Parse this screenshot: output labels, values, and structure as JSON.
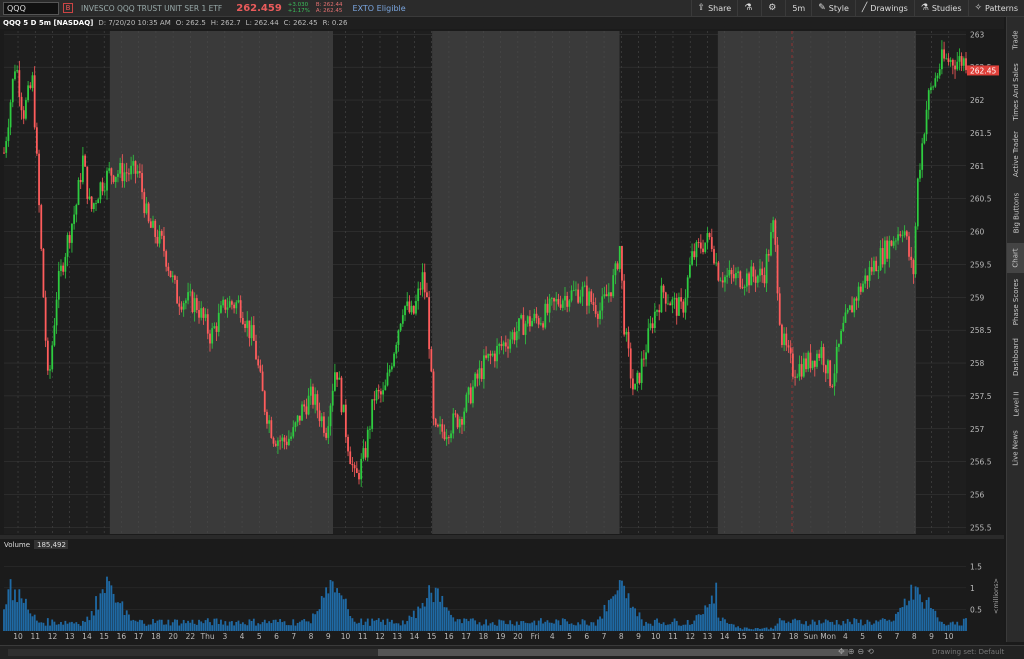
{
  "header": {
    "symbol": "QQQ",
    "symbol_flag": "B",
    "description": "INVESCO QQQ TRUST UNIT SER 1 ETF",
    "last": "262.459",
    "change": "+3.030",
    "change_pct": "+1.17%",
    "bid": "B: 262.44",
    "ask": "A: 262.45",
    "exto": "EXTO Eligible",
    "tools": [
      {
        "icon": "share-icon",
        "glyph": "⇪",
        "label": "Share"
      },
      {
        "icon": "flask-icon",
        "glyph": "⚗",
        "label": ""
      },
      {
        "icon": "gear-icon",
        "glyph": "⚙",
        "label": ""
      },
      {
        "icon": "timeframe-icon",
        "glyph": "",
        "label": "5m"
      },
      {
        "icon": "style-icon",
        "glyph": "✎",
        "label": "Style"
      },
      {
        "icon": "pencil-icon",
        "glyph": "╱",
        "label": "Drawings"
      },
      {
        "icon": "studies-icon",
        "glyph": "⚗",
        "label": "Studies"
      },
      {
        "icon": "patterns-icon",
        "glyph": "✧",
        "label": "Patterns"
      }
    ]
  },
  "studybar": {
    "title": "QQQ 5 D 5m [NASDAQ]",
    "date": "D: 7/20/20 10:35 AM",
    "open": "O: 262.5",
    "high": "H: 262.7",
    "low": "L: 262.44",
    "close": "C: 262.45",
    "range": "R: 0.26"
  },
  "volume": {
    "label": "Volume",
    "value": "185,492",
    "axis_label": "<millions>"
  },
  "price_badge": "262.45",
  "colors": {
    "up": "#2ecc40",
    "down": "#ff5c5c",
    "volume": "#1f6aa5",
    "extended": "#1e1e1e",
    "regular": "#3a3a3a"
  },
  "chart_data": {
    "type": "candlestick",
    "y_ticks": [
      "263",
      "262.5",
      "262",
      "261.5",
      "261",
      "260.5",
      "260",
      "259.5",
      "259",
      "258.5",
      "258",
      "257.5",
      "257",
      "256.5",
      "256",
      "255.5"
    ],
    "ylim": [
      255.4,
      263.05
    ],
    "x_ticks": [
      "10",
      "11",
      "12",
      "13",
      "14",
      "15",
      "16",
      "17",
      "18",
      "20",
      "22",
      "Thu",
      "3",
      "4",
      "5",
      "6",
      "7",
      "8",
      "9",
      "10",
      "11",
      "12",
      "13",
      "14",
      "15",
      "16",
      "17",
      "18",
      "19",
      "20",
      "Fri",
      "4",
      "5",
      "6",
      "7",
      "8",
      "9",
      "10",
      "11",
      "12",
      "13",
      "14",
      "15",
      "16",
      "17",
      "18",
      "Sun",
      "Mon",
      "4",
      "5",
      "6",
      "7",
      "8",
      "9",
      "10"
    ],
    "volume_ticks": [
      "1.5",
      "1",
      "0.5"
    ],
    "volume_ylim": [
      0,
      1.9
    ],
    "price_path": [
      [
        0,
        261.2
      ],
      [
        0.012,
        262.6
      ],
      [
        0.02,
        261.8
      ],
      [
        0.03,
        262.3
      ],
      [
        0.04,
        259.3
      ],
      [
        0.046,
        257.6
      ],
      [
        0.055,
        259.1
      ],
      [
        0.065,
        259.8
      ],
      [
        0.075,
        260.4
      ],
      [
        0.082,
        261.1
      ],
      [
        0.09,
        260.3
      ],
      [
        0.1,
        260.7
      ],
      [
        0.11,
        260.9
      ],
      [
        0.13,
        260.9
      ],
      [
        0.14,
        260.9
      ],
      [
        0.15,
        260.1
      ],
      [
        0.165,
        259.8
      ],
      [
        0.18,
        259.0
      ],
      [
        0.2,
        258.9
      ],
      [
        0.215,
        258.4
      ],
      [
        0.23,
        258.9
      ],
      [
        0.245,
        258.9
      ],
      [
        0.26,
        258.3
      ],
      [
        0.27,
        257.4
      ],
      [
        0.28,
        256.9
      ],
      [
        0.29,
        256.8
      ],
      [
        0.3,
        256.9
      ],
      [
        0.31,
        257.3
      ],
      [
        0.32,
        257.5
      ],
      [
        0.335,
        257.0
      ],
      [
        0.345,
        258.0
      ],
      [
        0.355,
        257.0
      ],
      [
        0.365,
        256.2
      ],
      [
        0.375,
        256.6
      ],
      [
        0.385,
        257.5
      ],
      [
        0.395,
        257.5
      ],
      [
        0.405,
        258.2
      ],
      [
        0.415,
        258.9
      ],
      [
        0.425,
        258.7
      ],
      [
        0.435,
        259.3
      ],
      [
        0.44,
        258.9
      ],
      [
        0.447,
        256.9
      ],
      [
        0.46,
        257.0
      ],
      [
        0.475,
        257.2
      ],
      [
        0.49,
        257.7
      ],
      [
        0.5,
        258.0
      ],
      [
        0.52,
        258.3
      ],
      [
        0.54,
        258.6
      ],
      [
        0.56,
        258.7
      ],
      [
        0.58,
        259.0
      ],
      [
        0.6,
        259.1
      ],
      [
        0.62,
        258.8
      ],
      [
        0.635,
        259.3
      ],
      [
        0.64,
        259.8
      ],
      [
        0.645,
        258.5
      ],
      [
        0.655,
        257.5
      ],
      [
        0.665,
        258.1
      ],
      [
        0.675,
        258.7
      ],
      [
        0.685,
        259.1
      ],
      [
        0.695,
        258.9
      ],
      [
        0.705,
        258.8
      ],
      [
        0.715,
        259.6
      ],
      [
        0.725,
        259.8
      ],
      [
        0.735,
        259.9
      ],
      [
        0.742,
        259.4
      ],
      [
        0.75,
        259.3
      ],
      [
        0.77,
        259.3
      ],
      [
        0.79,
        259.35
      ],
      [
        0.8,
        260.1
      ],
      [
        0.808,
        258.4
      ],
      [
        0.82,
        257.9
      ],
      [
        0.835,
        258.0
      ],
      [
        0.85,
        258.2
      ],
      [
        0.86,
        257.7
      ],
      [
        0.872,
        258.5
      ],
      [
        0.885,
        259.0
      ],
      [
        0.9,
        259.4
      ],
      [
        0.92,
        259.8
      ],
      [
        0.935,
        260.1
      ],
      [
        0.945,
        259.3
      ],
      [
        0.95,
        260.8
      ],
      [
        0.96,
        262.0
      ],
      [
        0.975,
        262.6
      ]
    ],
    "sessions": [
      {
        "from": 0.0,
        "to": 0.11,
        "kind": "extended"
      },
      {
        "from": 0.11,
        "to": 0.342,
        "kind": "regular"
      },
      {
        "from": 0.342,
        "to": 0.445,
        "kind": "extended"
      },
      {
        "from": 0.445,
        "to": 0.64,
        "kind": "regular"
      },
      {
        "from": 0.64,
        "to": 0.742,
        "kind": "extended"
      },
      {
        "from": 0.742,
        "to": 0.948,
        "kind": "regular"
      },
      {
        "from": 0.948,
        "to": 1.0,
        "kind": "extended"
      }
    ],
    "volume_spikes": [
      0.01,
      0.108,
      0.342,
      0.445,
      0.64,
      0.742,
      0.948
    ]
  },
  "sidebar": {
    "tabs": [
      "Trade",
      "Times And Sales",
      "Active Trader",
      "Big Buttons",
      "Chart",
      "Phase Scores",
      "Dashboard",
      "Level II",
      "Live News"
    ]
  },
  "bottombar": {
    "drawing_set": "Drawing set: Default"
  }
}
